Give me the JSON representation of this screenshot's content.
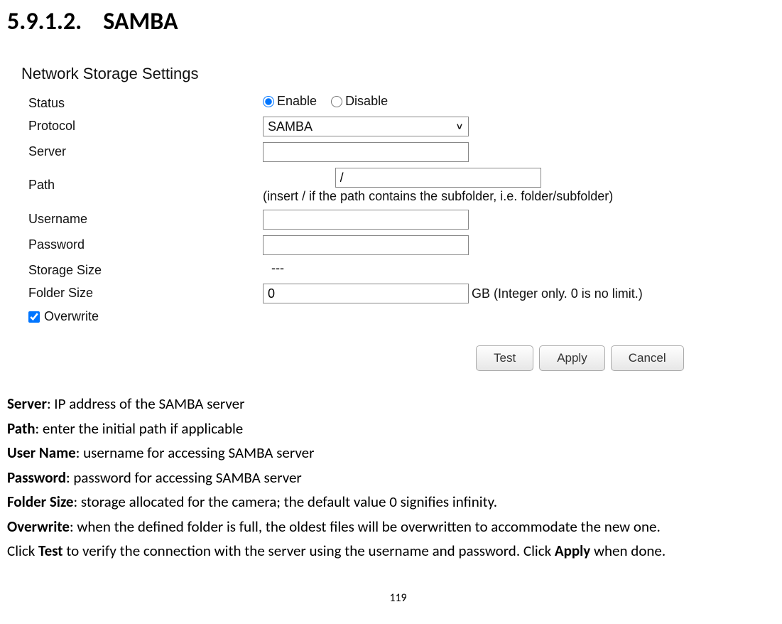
{
  "heading": {
    "number": "5.9.1.2.",
    "title": "SAMBA"
  },
  "panel": {
    "title": "Network Storage Settings",
    "status": {
      "label": "Status",
      "enable": "Enable",
      "disable": "Disable"
    },
    "protocol": {
      "label": "Protocol",
      "value": "SAMBA"
    },
    "server": {
      "label": "Server",
      "value": ""
    },
    "path": {
      "label": "Path",
      "value": "/",
      "hint": "(insert / if the path contains the subfolder, i.e. folder/subfolder)"
    },
    "username": {
      "label": "Username",
      "value": ""
    },
    "password": {
      "label": "Password",
      "value": ""
    },
    "storage_size": {
      "label": "Storage Size",
      "value": "---"
    },
    "folder_size": {
      "label": "Folder Size",
      "value": "0",
      "hint": "GB (Integer only. 0 is no limit.)"
    },
    "overwrite": {
      "label": "Overwrite"
    },
    "buttons": {
      "test": "Test",
      "apply": "Apply",
      "cancel": "Cancel"
    }
  },
  "desc": {
    "server_t": "Server",
    "server_d": ": IP address of the SAMBA server",
    "path_t": "Path",
    "path_d": ": enter the initial path if applicable",
    "user_t": "User Name",
    "user_d": ": username for accessing SAMBA server",
    "pass_t": "Password",
    "pass_d": ": password for accessing SAMBA server",
    "folder_t": "Folder Size",
    "folder_d": ": storage allocated for the camera; the default value 0 signifies infinity.",
    "over_t": "Overwrite",
    "over_d": ": when the defined folder is full, the oldest files will be overwritten to accommodate the new one.",
    "click_pre": "Click ",
    "test_b": "Test",
    "click_mid": " to verify the connection with the server using the username and password. Click ",
    "apply_b": "Apply",
    "click_end": " when done."
  },
  "page_number": "119"
}
